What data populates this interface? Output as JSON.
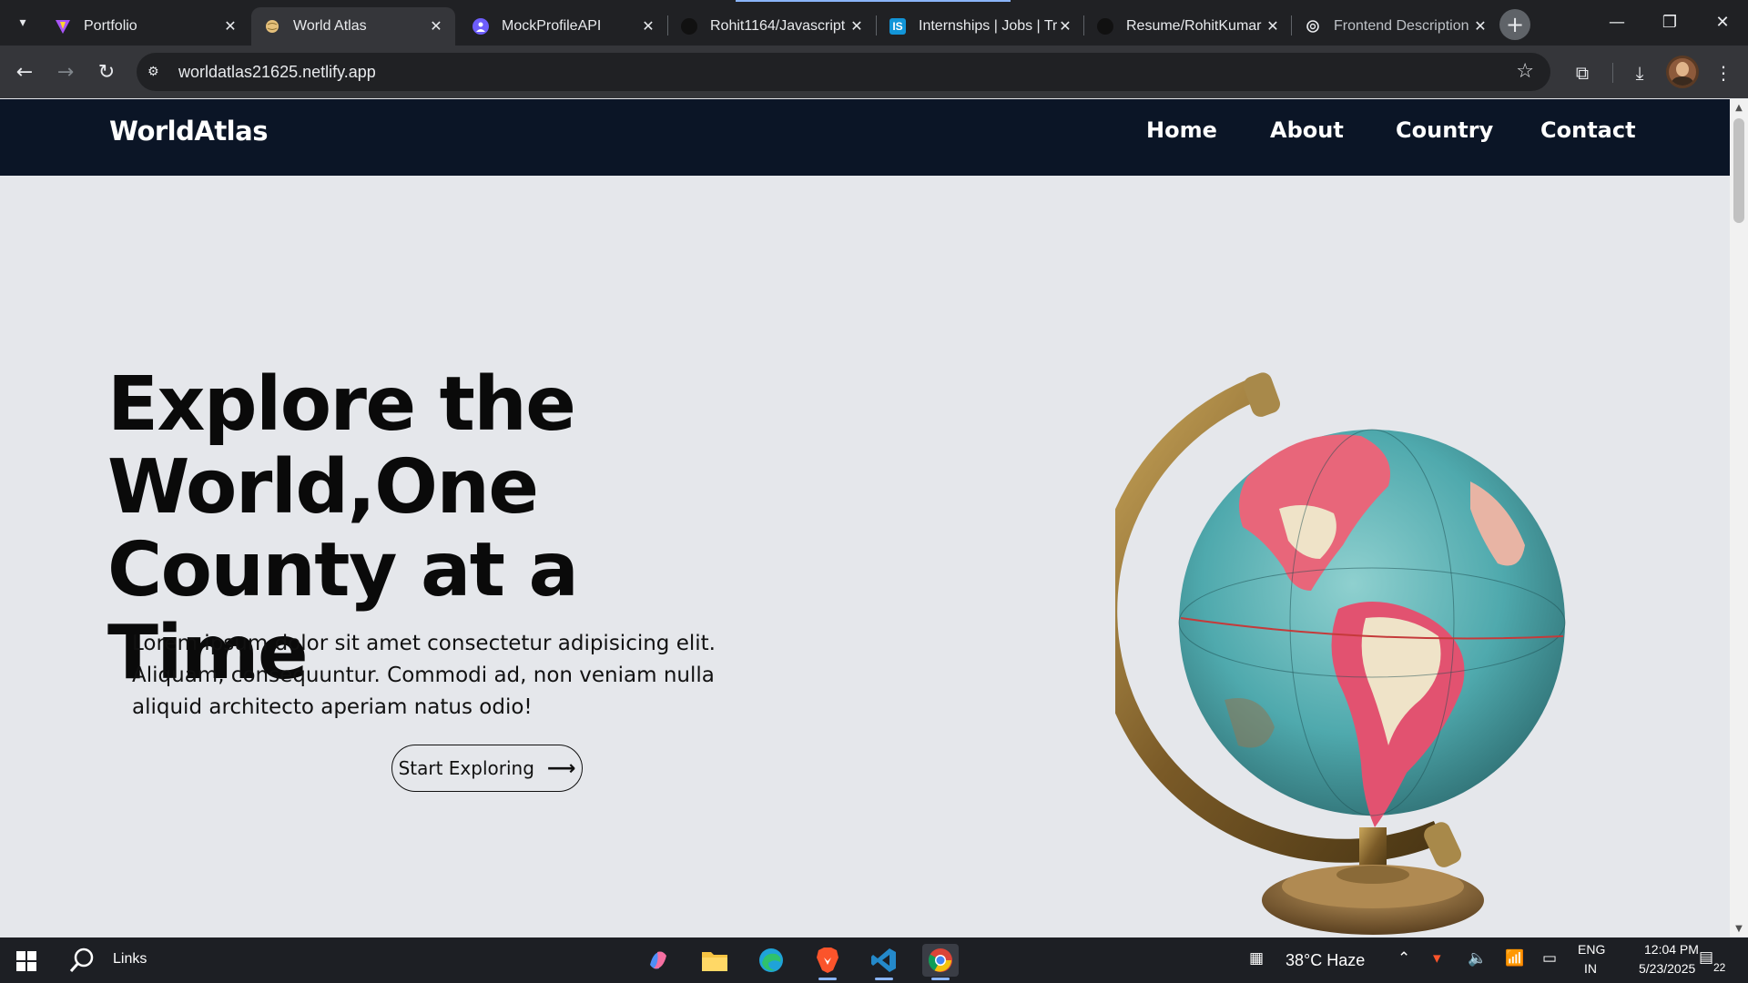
{
  "browser": {
    "tabs": [
      {
        "title": "Portfolio",
        "favicon": "vite-icon",
        "color": "#a855f7",
        "active": false
      },
      {
        "title": "World Atlas",
        "favicon": "globe-icon",
        "color": "#e5c07b",
        "active": true
      },
      {
        "title": "MockProfileAPI",
        "favicon": "profile-icon",
        "color": "#6d5dfc",
        "active": false
      },
      {
        "title": "Rohit1164/Javascript",
        "favicon": "github-icon",
        "color": "#111111",
        "active": false
      },
      {
        "title": "Internships | Jobs | Tr",
        "favicon": "internshala-icon",
        "color": "#1295d8",
        "active": false
      },
      {
        "title": "Resume/RohitKumar",
        "favicon": "github-icon",
        "color": "#111111",
        "active": false
      },
      {
        "title": "Frontend Description",
        "favicon": "openai-icon",
        "color": "#e8eaed",
        "active": false
      }
    ],
    "url": "worldatlas21625.netlify.app"
  },
  "site": {
    "brand": "WorldAtlas",
    "nav": [
      "Home",
      "About",
      "Country",
      "Contact"
    ],
    "hero": {
      "title_line1": "Explore the",
      "title_line2": "World,One",
      "title_line3": "County at a Time",
      "paragraph": "Lorem ipsum dolor sit amet consectetur adipisicing elit. Aliquam, consequuntur. Commodi ad, non veniam nulla aliquid architecto aperiam natus odio!",
      "cta_label": "Start Exploring",
      "cta_icon": "arrow-right-icon"
    },
    "colors": {
      "header_bg": "#0b1526",
      "page_bg": "#e5e7eb"
    }
  },
  "taskbar": {
    "search_label": "Links",
    "weather": "38°C  Haze",
    "lang_top": "ENG",
    "lang_bottom": "IN",
    "time": "12:04 PM",
    "date": "5/23/2025",
    "notifications": "22"
  }
}
